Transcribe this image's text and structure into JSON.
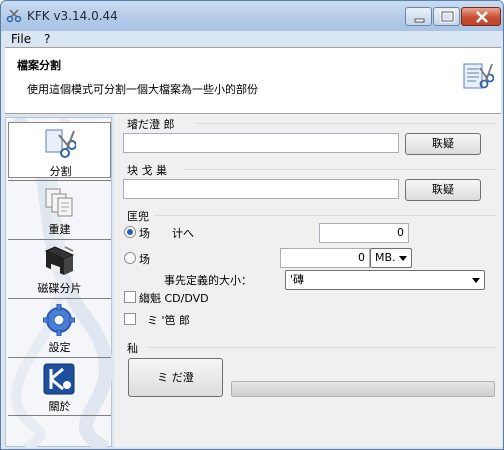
{
  "window": {
    "title": "KFK v3.14.0.44"
  },
  "menu": {
    "items": [
      "File",
      "?"
    ]
  },
  "header": {
    "title": "檔案分割",
    "description": "使用這個模式可分割一個大檔案為一些小的部份",
    "icon": "split-file-icon"
  },
  "sidebar": {
    "items": [
      {
        "label": "分割",
        "icon": "scissors-icon",
        "active": true
      },
      {
        "label": "重建",
        "icon": "rebuild-pages-icon",
        "active": false
      },
      {
        "label": "磁碟分片",
        "icon": "floppy-disk-icon",
        "active": false
      },
      {
        "label": "設定",
        "icon": "gear-icon",
        "active": false
      },
      {
        "label": "關於",
        "icon": "kfk-logo-icon",
        "active": false
      }
    ]
  },
  "main": {
    "source_group_label": "璿だ澄  郎",
    "source_value": "",
    "browse1_label": "聅疑",
    "dest_group_label": "块  戈  巢",
    "dest_value": "",
    "browse2_label": "聅疑",
    "options_group_label": "匡兜",
    "radio1_label": "场",
    "radio1_suffix": "计へ",
    "radio1_value": "0",
    "radio1_checked": true,
    "radio2_label": "场",
    "radio2_value": "0",
    "radio2_checked": false,
    "unit_select": "MB.",
    "predefined_label": "事先定義的大小：",
    "predefined_select": "'磚",
    "check1_label": "縐魁    CD/DVD",
    "check2_label": "ミ  '笆         郎",
    "action_group_label": "秈",
    "start_button_label": "ミ  だ澄",
    "progress": 0
  }
}
